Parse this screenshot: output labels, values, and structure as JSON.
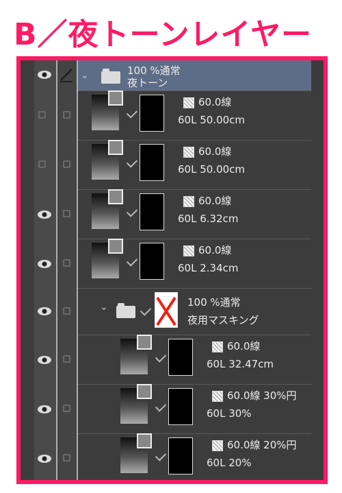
{
  "title": "B／夜トーンレイヤー",
  "colors": {
    "accent": "#ff1a66",
    "panel": "#3c3c3c",
    "selected_row": "#5e6d87"
  },
  "folder_top": {
    "mode": "100 %通常",
    "name": "夜トーン"
  },
  "layers": [
    {
      "tone": "60.0線",
      "info": "60L 50.00cm",
      "visible": false
    },
    {
      "tone": "60.0線",
      "info": "60L 50.00cm",
      "visible": false
    },
    {
      "tone": "60.0線",
      "info": "60L 6.32cm",
      "visible": true
    },
    {
      "tone": "60.0線",
      "info": "60L 2.34cm",
      "visible": true
    }
  ],
  "folder_sub": {
    "mode": "100 %通常",
    "name": "夜用マスキング"
  },
  "sublayers": [
    {
      "tone": "60.0線",
      "info": "60L 32.47cm"
    },
    {
      "tone": "60.0線 30%円",
      "info": "60L 30%"
    },
    {
      "tone": "60.0線 20%円",
      "info": "60L 20%"
    }
  ],
  "icons": {
    "visibility": "eye-icon",
    "pen": "pen-icon",
    "folder": "folder-icon",
    "mask_x": "cross-icon"
  }
}
